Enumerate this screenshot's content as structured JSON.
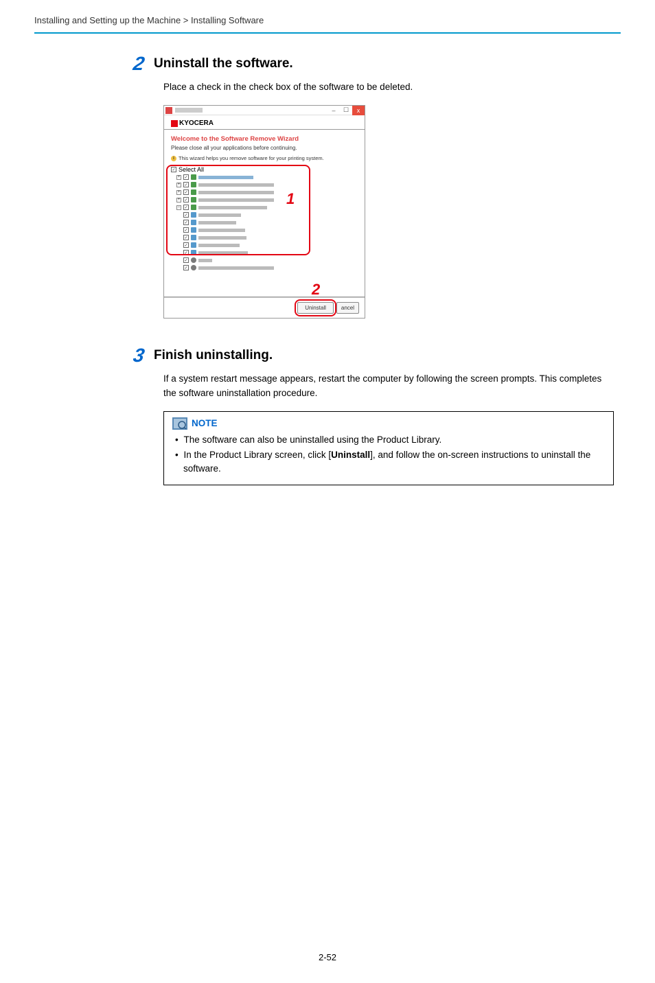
{
  "page": {
    "breadcrumb": "Installing and Setting up the Machine > Installing Software",
    "page_number": "2-52"
  },
  "steps": {
    "step2": {
      "number": "2",
      "title": "Uninstall the software.",
      "body": "Place a check in the check box of the software to be deleted."
    },
    "step3": {
      "number": "3",
      "title": "Finish uninstalling.",
      "body": "If a system restart message appears, restart the computer by following the screen prompts. This completes the software uninstallation procedure."
    }
  },
  "wizard_screenshot": {
    "brand": "KYOCERA",
    "heading": "Welcome to the Software Remove Wizard",
    "subheading": "Please close all your applications before continuing.",
    "info_text": "This wizard helps you remove software for your printing system.",
    "select_all_label": "Select All",
    "uninstall_button": "Uninstall",
    "cancel_button": "ancel",
    "callout1": "1",
    "callout2": "2",
    "window_controls": {
      "minimize": "–",
      "maximize": "☐",
      "close": "x"
    }
  },
  "note": {
    "title": "NOTE",
    "bullet1": "The software can also be uninstalled using the Product Library.",
    "bullet2_pre": "In the Product Library screen, click [",
    "bullet2_bold": "Uninstall",
    "bullet2_post": "], and follow the on-screen instructions to uninstall the software."
  }
}
